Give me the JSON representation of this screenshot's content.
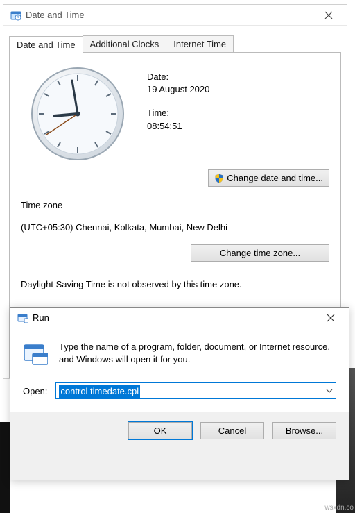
{
  "dt_window": {
    "title": "Date and Time",
    "tabs": [
      "Date and Time",
      "Additional Clocks",
      "Internet Time"
    ],
    "date_label": "Date:",
    "date_value": "19 August 2020",
    "time_label": "Time:",
    "time_value": "08:54:51",
    "change_dt_btn": "Change date and time...",
    "tz_section_label": "Time zone",
    "tz_value": "(UTC+05:30) Chennai, Kolkata, Mumbai, New Delhi",
    "change_tz_btn": "Change time zone...",
    "dst_note": "Daylight Saving Time is not observed by this time zone."
  },
  "run_window": {
    "title": "Run",
    "message": "Type the name of a program, folder, document, or Internet resource, and Windows will open it for you.",
    "open_label": "Open:",
    "open_value": "control timedate.cpl",
    "ok": "OK",
    "cancel": "Cancel",
    "browse": "Browse..."
  },
  "watermark": "wsxdn.co"
}
